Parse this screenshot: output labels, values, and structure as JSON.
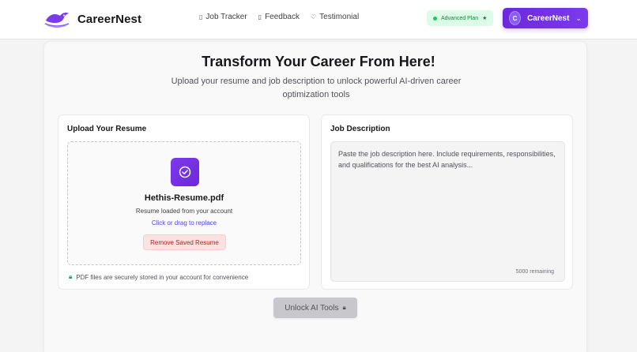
{
  "brand": {
    "name": "CareerNest"
  },
  "nav": [
    {
      "label": "Job Tracker",
      "icon": "clipboard-icon"
    },
    {
      "label": "Feedback",
      "icon": "message-icon"
    },
    {
      "label": "Testimonial",
      "icon": "heart-icon"
    }
  ],
  "plan_badge": {
    "label": "Advanced Plan",
    "color": "#15803d"
  },
  "user": {
    "initial": "C",
    "name": "CareerNest"
  },
  "hero": {
    "title": "Transform Your Career From Here!",
    "subtitle": "Upload your resume and job description to unlock powerful AI-driven career optimization tools"
  },
  "upload": {
    "title": "Upload Your Resume",
    "file_name": "Hethis-Resume.pdf",
    "status": "Resume loaded from your account",
    "replace_label": "Click or drag to replace",
    "remove_label": "Remove Saved Resume",
    "secure_note": "PDF files are securely stored in your account for convenience"
  },
  "job_description": {
    "title": "Job Description",
    "placeholder": "Paste the job description here. Include requirements, responsibilities, and qualifications for the best AI analysis...",
    "value": "",
    "remaining": "5000 remaining"
  },
  "unlock_button": {
    "label": "Unlock AI Tools"
  },
  "colors": {
    "accent": "#6d28d9",
    "danger": "#b91c1c",
    "success": "#16a34a"
  }
}
